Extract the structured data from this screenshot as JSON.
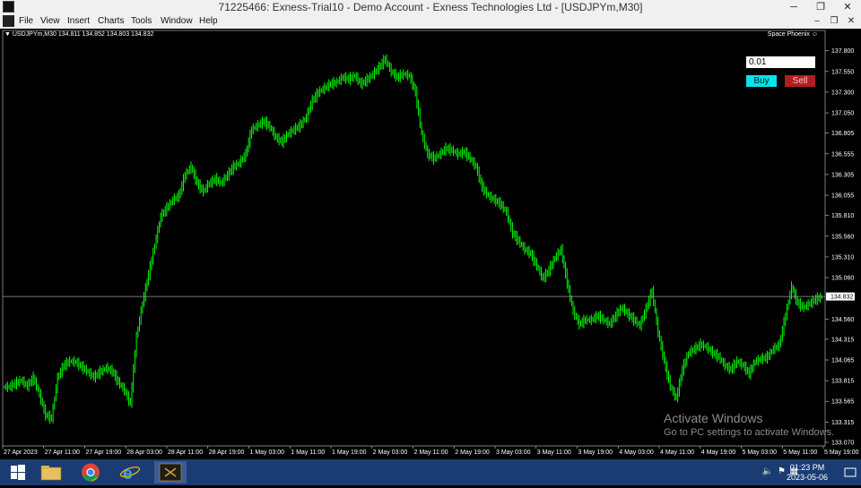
{
  "window": {
    "title": "71225466: Exness-Trial10 - Demo Account - Exness Technologies Ltd - [USDJPYm,M30]",
    "minimize": "─",
    "restore": "❐",
    "close": "✕"
  },
  "menu": {
    "items": [
      "File",
      "View",
      "Insert",
      "Charts",
      "Tools",
      "Window",
      "Help"
    ],
    "mdi_minimize": "–",
    "mdi_restore": "❐",
    "mdi_close": "✕"
  },
  "chart": {
    "symbol_info": "USDJPYm,M30  134.811 134.852 134.803 134.832",
    "ea_name": "Space Phoenix",
    "current_price": "134.832",
    "lot_value": "0.01",
    "buy_label": "Buy",
    "sell_label": "Sell",
    "candle_color": "#00ff00",
    "background": "#000000"
  },
  "chart_data": {
    "type": "line",
    "symbol": "USDJPYm",
    "timeframe": "M30",
    "ylim": [
      133.07,
      137.97
    ],
    "y_ticks": [
      "137.800",
      "137.550",
      "137.300",
      "137.050",
      "136.805",
      "136.555",
      "136.305",
      "136.055",
      "135.810",
      "135.560",
      "135.310",
      "135.060",
      "134.560",
      "134.315",
      "134.065",
      "133.815",
      "133.565",
      "133.315",
      "133.070"
    ],
    "x_ticks": [
      "27 Apr 2023",
      "27 Apr 11:00",
      "27 Apr 19:00",
      "28 Apr 03:00",
      "28 Apr 11:00",
      "28 Apr 19:00",
      "1 May 03:00",
      "1 May 11:00",
      "1 May 19:00",
      "2 May 03:00",
      "2 May 11:00",
      "2 May 19:00",
      "3 May 03:00",
      "3 May 11:00",
      "3 May 19:00",
      "4 May 03:00",
      "4 May 11:00",
      "4 May 19:00",
      "5 May 03:00",
      "5 May 11:00",
      "5 May 19:00"
    ],
    "current_price": 134.832,
    "series": [
      {
        "values": [
          133.74,
          133.78,
          133.82,
          133.75,
          133.85,
          133.65,
          133.4,
          133.36,
          133.85,
          134.0,
          134.05,
          134.04,
          133.98,
          133.92,
          133.86,
          133.92,
          133.97,
          133.93,
          133.8,
          133.7,
          133.54,
          134.35,
          134.75,
          135.1,
          135.45,
          135.8,
          135.9,
          136.0,
          136.05,
          136.3,
          136.4,
          136.2,
          136.1,
          136.2,
          136.25,
          136.2,
          136.3,
          136.4,
          136.45,
          136.55,
          136.85,
          136.9,
          136.95,
          136.88,
          136.75,
          136.7,
          136.8,
          136.85,
          136.9,
          137.0,
          137.2,
          137.3,
          137.35,
          137.4,
          137.42,
          137.48,
          137.46,
          137.5,
          137.4,
          137.45,
          137.52,
          137.6,
          137.7,
          137.55,
          137.48,
          137.52,
          137.5,
          137.3,
          136.8,
          136.55,
          136.5,
          136.55,
          136.62,
          136.6,
          136.55,
          136.58,
          136.5,
          136.4,
          136.15,
          136.05,
          136.0,
          135.95,
          135.85,
          135.6,
          135.5,
          135.4,
          135.35,
          135.2,
          135.05,
          135.15,
          135.3,
          135.4,
          135.0,
          134.65,
          134.5,
          134.55,
          134.55,
          134.6,
          134.55,
          134.5,
          134.6,
          134.7,
          134.62,
          134.55,
          134.48,
          134.68,
          134.9,
          134.4,
          134.05,
          133.75,
          133.6,
          133.95,
          134.15,
          134.2,
          134.25,
          134.22,
          134.15,
          134.1,
          134.0,
          133.95,
          134.05,
          134.0,
          133.9,
          134.05,
          134.08,
          134.1,
          134.2,
          134.25,
          134.6,
          134.95,
          134.75,
          134.7,
          134.75,
          134.8,
          134.83
        ]
      }
    ]
  },
  "watermark": {
    "line1": "Activate Windows",
    "line2": "Go to PC settings to activate Windows."
  },
  "taskbar": {
    "time": "01:23 PM",
    "date": "2023-05-06",
    "apps": [
      "start",
      "file-explorer",
      "chrome",
      "internet-explorer",
      "exness-terminal"
    ]
  }
}
